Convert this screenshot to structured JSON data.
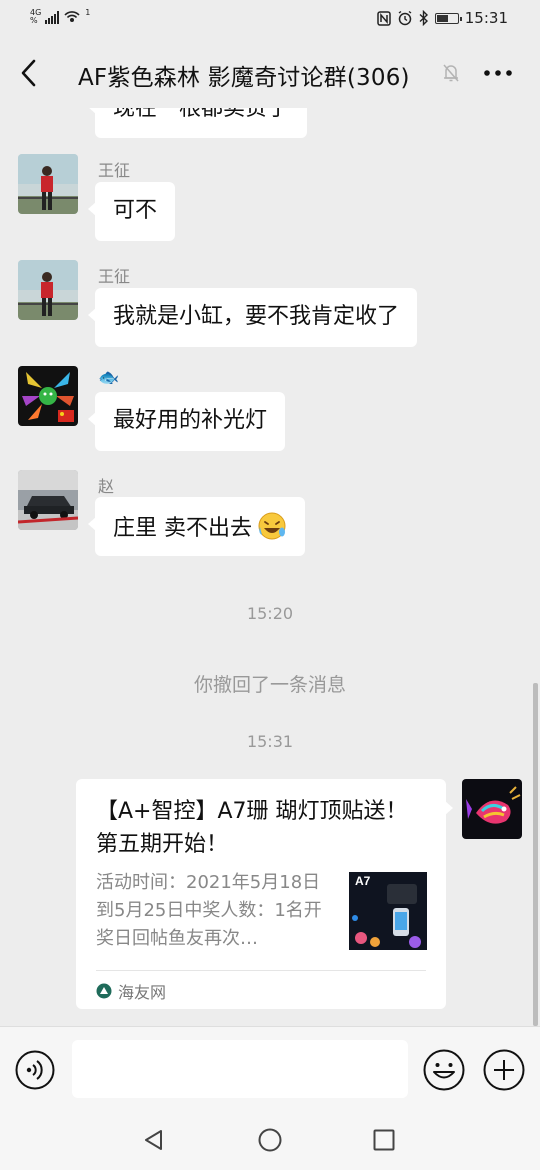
{
  "status_bar": {
    "network_label": "4G",
    "speed_label": "%",
    "hotspot_mark": "1",
    "time": "15:31",
    "battery_level": 0.6,
    "icons": [
      "nfc-icon",
      "alarm-icon",
      "bluetooth-icon",
      "battery-icon"
    ]
  },
  "header": {
    "title": "AF紫色森林 影魔奇讨论群(306)",
    "icons": [
      "back-arrow-icon",
      "mute-bell-icon",
      "more-dots-icon"
    ]
  },
  "messages": [
    {
      "sender": "",
      "text": "现在一根都卖贵了"
    },
    {
      "sender": "王征",
      "text": "可不"
    },
    {
      "sender": "王征",
      "text": "我就是小缸，要不我肯定收了"
    },
    {
      "sender": "🐟",
      "text": "最好用的补光灯"
    },
    {
      "sender": "赵",
      "text": "庄里 卖不出去",
      "emoji": "laughing-tears-emoji"
    }
  ],
  "timestamps": [
    "15:20",
    "15:31"
  ],
  "system_message": "你撤回了一条消息",
  "shared_card": {
    "title": "【A+智控】A7珊 瑚灯顶贴送！第五期开始！",
    "description": "活动时间：2021年5月18日到5月25日中奖人数：1名开奖日回帖鱼友再次…",
    "thumbnail_label": "A7",
    "source": "海友网"
  },
  "input_bar": {
    "placeholder": "",
    "icons": [
      "voice-icon",
      "emoji-icon",
      "plus-icon"
    ]
  },
  "nav_bar": {
    "icons": [
      "nav-back-icon",
      "nav-home-icon",
      "nav-recents-icon"
    ]
  },
  "colors": {
    "background": "#ededed",
    "bubble": "#ffffff",
    "muted_text": "#888888"
  }
}
